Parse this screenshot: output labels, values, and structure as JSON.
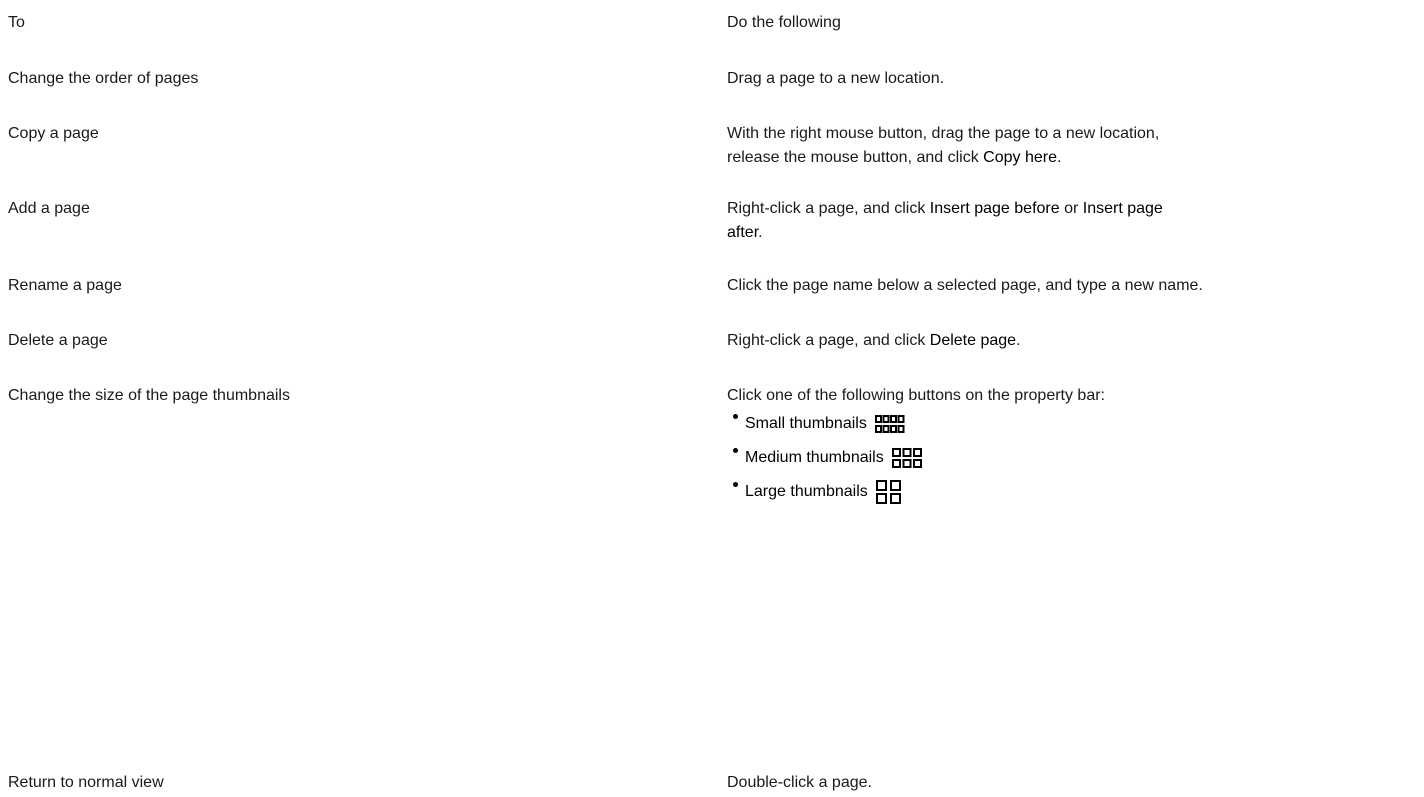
{
  "table": {
    "header": {
      "col1": "To",
      "col2": "Do the following"
    },
    "rows": [
      {
        "task": "Change the order of pages",
        "action": [
          "Drag a page to a new location."
        ]
      },
      {
        "task": "Copy a page",
        "action": [
          "With the right mouse button, drag the page to a new location,",
          "release the mouse button, and click ",
          "Copy here",
          "."
        ]
      },
      {
        "task": "Add a page",
        "action": [
          "Right-click a page, and click ",
          "Insert page before",
          " or ",
          "Insert page",
          "after",
          "."
        ]
      },
      {
        "task": "Rename a page",
        "action": [
          "Click the page name below a selected page, and type a new name."
        ]
      },
      {
        "task": "Delete a page",
        "action": [
          "Right-click a page, and click ",
          "Delete page",
          "."
        ]
      },
      {
        "task": "Change the size of the page thumbnails",
        "action": [
          "Click one of the following buttons on the property bar:"
        ],
        "options": [
          {
            "label": "Small thumbnails",
            "icon": "small-thumbnails-icon"
          },
          {
            "label": "Medium thumbnails",
            "icon": "medium-thumbnails-icon"
          },
          {
            "label": "Large thumbnails",
            "icon": "large-thumbnails-icon"
          }
        ]
      },
      {
        "task": "Return to normal view",
        "action": [
          "Double-click a page."
        ]
      }
    ]
  }
}
